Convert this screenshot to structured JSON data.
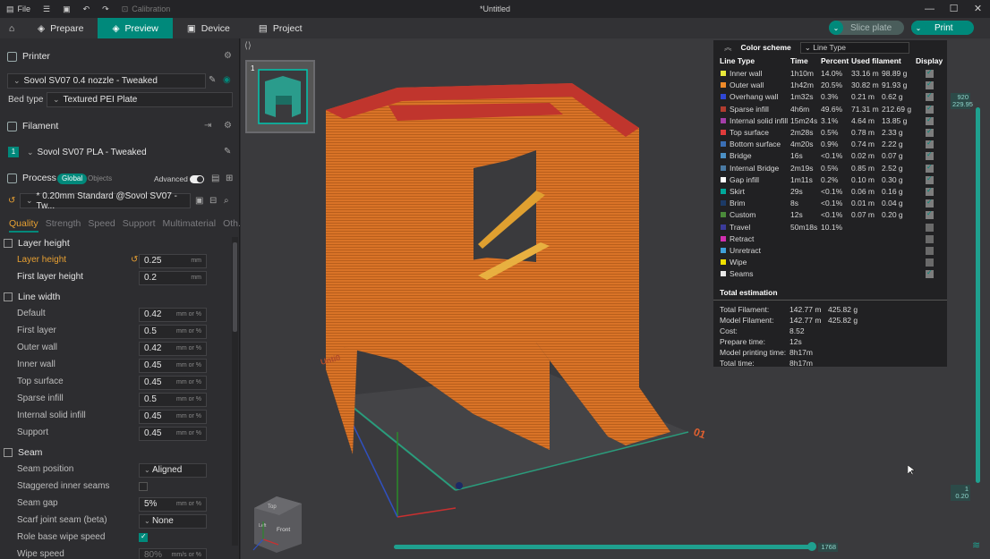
{
  "titlebar": {
    "file_label": "File",
    "calibration_label": "Calibration",
    "title": "*Untitled"
  },
  "tabs": [
    {
      "label": "Prepare"
    },
    {
      "label": "Preview"
    },
    {
      "label": "Device"
    },
    {
      "label": "Project"
    }
  ],
  "actions": {
    "slice": "Slice plate",
    "print": "Print"
  },
  "printer": {
    "header": "Printer",
    "name": "Sovol SV07 0.4 nozzle - Tweaked",
    "bed_type_label": "Bed type",
    "bed_type": "Textured PEI Plate"
  },
  "filament": {
    "header": "Filament",
    "index": "1",
    "name": "Sovol SV07 PLA - Tweaked"
  },
  "process": {
    "header": "Process",
    "global": "Global",
    "objects": "Objects",
    "advanced": "Advanced",
    "preset": "* 0.20mm Standard @Sovol SV07 - Tw...",
    "tabs": [
      "Quality",
      "Strength",
      "Speed",
      "Support",
      "Multimaterial",
      "Oth..."
    ]
  },
  "settings": {
    "layer_height_group": "Layer height",
    "layer_height_label": "Layer height",
    "layer_height": "0.25",
    "first_layer_height_label": "First layer height",
    "first_layer_height": "0.2",
    "unit_mm": "mm",
    "unit_mm_pct": "mm or %",
    "unit_mms": "mm/s or %",
    "line_width_group": "Line width",
    "default_label": "Default",
    "default": "0.42",
    "first_layer_label": "First layer",
    "first_layer": "0.5",
    "outer_wall_label": "Outer wall",
    "outer_wall": "0.42",
    "inner_wall_label": "Inner wall",
    "inner_wall": "0.45",
    "top_surface_label": "Top surface",
    "top_surface": "0.45",
    "sparse_infill_label": "Sparse infill",
    "sparse_infill": "0.5",
    "internal_solid_label": "Internal solid infill",
    "internal_solid": "0.45",
    "support_label": "Support",
    "support": "0.45",
    "seam_group": "Seam",
    "seam_position_label": "Seam position",
    "seam_position": "Aligned",
    "staggered_label": "Staggered inner seams",
    "seam_gap_label": "Seam gap",
    "seam_gap": "5%",
    "scarf_label": "Scarf joint seam (beta)",
    "scarf": "None",
    "role_base_label": "Role base wipe speed",
    "wipe_speed_label": "Wipe speed",
    "wipe_speed": "80%"
  },
  "legend": {
    "color_scheme_label": "Color scheme",
    "color_scheme": "Line Type",
    "headers": {
      "type": "Line Type",
      "time": "Time",
      "percent": "Percent",
      "used": "Used filament",
      "display": "Display"
    },
    "rows": [
      {
        "name": "Inner wall",
        "time": "1h10m",
        "pct": "14.0%",
        "len": "33.16 m",
        "g": "98.89 g",
        "color": "#e8e83a",
        "on": true
      },
      {
        "name": "Outer wall",
        "time": "1h42m",
        "pct": "20.5%",
        "len": "30.82 m",
        "g": "91.93 g",
        "color": "#ef8a29",
        "on": true
      },
      {
        "name": "Overhang wall",
        "time": "1m32s",
        "pct": "0.3%",
        "len": "0.21 m",
        "g": "0.62 g",
        "color": "#2f47d6",
        "on": true
      },
      {
        "name": "Sparse infill",
        "time": "4h6m",
        "pct": "49.6%",
        "len": "71.31 m",
        "g": "212.69 g",
        "color": "#b13c2f",
        "on": true
      },
      {
        "name": "Internal solid infill",
        "time": "15m24s",
        "pct": "3.1%",
        "len": "4.64 m",
        "g": "13.85 g",
        "color": "#a33ea8",
        "on": true
      },
      {
        "name": "Top surface",
        "time": "2m28s",
        "pct": "0.5%",
        "len": "0.78 m",
        "g": "2.33 g",
        "color": "#e03b3b",
        "on": true
      },
      {
        "name": "Bottom surface",
        "time": "4m20s",
        "pct": "0.9%",
        "len": "0.74 m",
        "g": "2.22 g",
        "color": "#3a6fb5",
        "on": true
      },
      {
        "name": "Bridge",
        "time": "16s",
        "pct": "<0.1%",
        "len": "0.02 m",
        "g": "0.07 g",
        "color": "#4b8fc4",
        "on": true
      },
      {
        "name": "Internal Bridge",
        "time": "2m19s",
        "pct": "0.5%",
        "len": "0.85 m",
        "g": "2.52 g",
        "color": "#4a7aa3",
        "on": true
      },
      {
        "name": "Gap infill",
        "time": "1m11s",
        "pct": "0.2%",
        "len": "0.10 m",
        "g": "0.30 g",
        "color": "#ffffff",
        "on": true
      },
      {
        "name": "Skirt",
        "time": "29s",
        "pct": "<0.1%",
        "len": "0.06 m",
        "g": "0.16 g",
        "color": "#00a89a",
        "on": true
      },
      {
        "name": "Brim",
        "time": "8s",
        "pct": "<0.1%",
        "len": "0.01 m",
        "g": "0.04 g",
        "color": "#1c3a66",
        "on": true
      },
      {
        "name": "Custom",
        "time": "12s",
        "pct": "<0.1%",
        "len": "0.07 m",
        "g": "0.20 g",
        "color": "#4a8a3a",
        "on": true
      },
      {
        "name": "Travel",
        "time": "50m18s",
        "pct": "10.1%",
        "len": "",
        "g": "",
        "color": "#3b3b9a",
        "on": false
      },
      {
        "name": "Retract",
        "time": "",
        "pct": "",
        "len": "",
        "g": "",
        "color": "#d22fb0",
        "on": false
      },
      {
        "name": "Unretract",
        "time": "",
        "pct": "",
        "len": "",
        "g": "",
        "color": "#3fa0d9",
        "on": false
      },
      {
        "name": "Wipe",
        "time": "",
        "pct": "",
        "len": "",
        "g": "",
        "color": "#f0e000",
        "on": false
      },
      {
        "name": "Seams",
        "time": "",
        "pct": "",
        "len": "",
        "g": "",
        "color": "#e8e8e8",
        "on": true
      }
    ],
    "total_header": "Total estimation",
    "totals": [
      {
        "label": "Total Filament:",
        "v1": "142.77 m",
        "v2": "425.82 g"
      },
      {
        "label": "Model Filament:",
        "v1": "142.77 m",
        "v2": "425.82 g"
      },
      {
        "label": "Cost:",
        "v1": "8.52",
        "v2": ""
      },
      {
        "label": "Prepare time:",
        "v1": "12s",
        "v2": ""
      },
      {
        "label": "Model printing time:",
        "v1": "8h17m",
        "v2": ""
      },
      {
        "label": "Total time:",
        "v1": "8h17m",
        "v2": ""
      }
    ]
  },
  "viewport": {
    "plate_number": "1",
    "top_tag_1": "920",
    "top_tag_2": "229.95",
    "bottom_tag_1": "1",
    "bottom_tag_2": "0.20",
    "slider_tag": "1768",
    "cube_top": "Top",
    "cube_front": "Front",
    "cube_left": "Left",
    "bed_label_right": "01",
    "bed_label_left": "Unti0"
  }
}
